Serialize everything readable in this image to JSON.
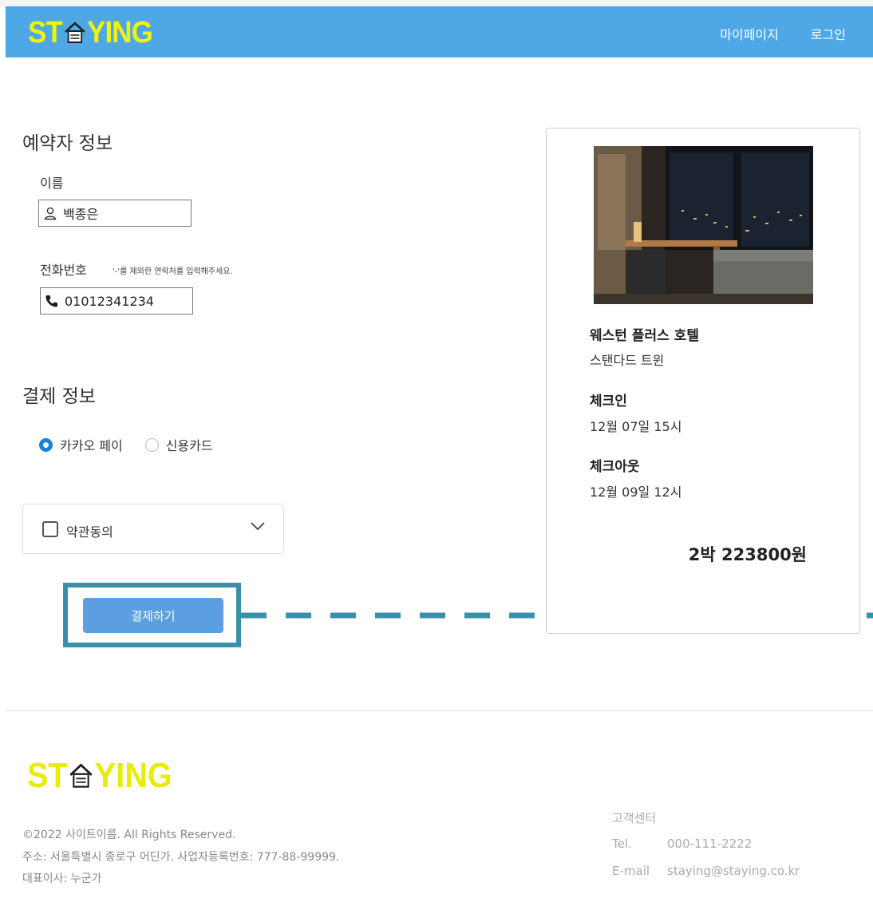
{
  "header": {
    "logo_left": "ST",
    "logo_right": "YING",
    "nav": [
      "마이페이지",
      "로그인"
    ]
  },
  "booker": {
    "title": "예약자 정보",
    "name_label": "이름",
    "name_value": "백종은",
    "phone_label": "전화번호",
    "phone_hint": "'-'를 제외한 연락처를 입력해주세요.",
    "phone_value": "01012341234"
  },
  "payment": {
    "title": "결제 정보",
    "options": [
      "카카오 페이",
      "신용카드"
    ],
    "selected": "카카오 페이",
    "terms_label": "약관동의",
    "terms_checked": false,
    "pay_button": "결제하기"
  },
  "summary": {
    "hotel_name": "웨스턴 플러스 호텔",
    "room_type": "스탠다드 트윈",
    "checkin_label": "체크인",
    "checkin_value": "12월 07일 15시",
    "checkout_label": "체크아웃",
    "checkout_value": "12월 09일 12시",
    "total": "2박 223800원"
  },
  "footer": {
    "logo_left": "ST",
    "logo_right": "YING",
    "copyright": "©2022 사이트이름. All Rights Reserved.",
    "address": "주소: 서울특별시 종로구 어딘가. 사업자등록번호: 777-88-99999.",
    "ceo": "대표이사: 누군가",
    "cs_title": "고객센터",
    "tel_label": "Tel.",
    "tel_value": "000-111-2222",
    "email_label": "E-mail",
    "email_value": "staying@staying.co.kr"
  },
  "colors": {
    "header_bg": "#4ea8e6",
    "logo": "#f2f20c",
    "pay_button": "#5b9fe0",
    "highlight_frame": "#3a8fab",
    "radio_selected": "#1b7fe0"
  }
}
